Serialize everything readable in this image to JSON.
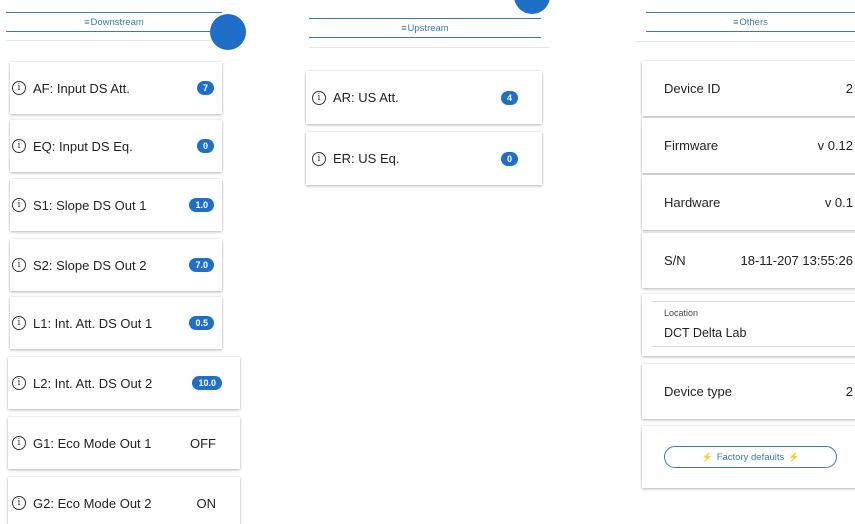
{
  "downstream": {
    "tab_label": "Downstream",
    "items": [
      {
        "label": "AF: Input DS Att.",
        "value": "7",
        "style": "badge"
      },
      {
        "label": "EQ: Input DS Eq.",
        "value": "0",
        "style": "badge"
      },
      {
        "label": "S1: Slope DS Out 1",
        "value": "1.0",
        "style": "badge"
      },
      {
        "label": "S2: Slope DS Out 2",
        "value": "7.0",
        "style": "badge"
      },
      {
        "label": "L1: Int. Att. DS Out 1",
        "value": "0.5",
        "style": "badge"
      },
      {
        "label": "L2: Int. Att. DS Out 2",
        "value": "10.0",
        "style": "badge"
      },
      {
        "label": "G1: Eco Mode Out 1",
        "value": "OFF",
        "style": "plain"
      },
      {
        "label": "G2: Eco Mode Out 2",
        "value": "ON",
        "style": "plain"
      }
    ]
  },
  "upstream": {
    "tab_label": "Upstream",
    "items": [
      {
        "label": "AR: US Att.",
        "value": "4",
        "style": "badge"
      },
      {
        "label": "ER: US Eq.",
        "value": "0",
        "style": "badge"
      }
    ]
  },
  "others": {
    "tab_label": "Others",
    "device_id": {
      "label": "Device ID",
      "value": "2"
    },
    "firmware": {
      "label": "Firmware",
      "value": "v 0.12"
    },
    "hardware": {
      "label": "Hardware",
      "value": "v 0.1"
    },
    "serial": {
      "label": "S/N",
      "value": "18-11-207 13:55:26"
    },
    "location": {
      "label": "Location",
      "value": "DCT Delta Lab"
    },
    "device_type": {
      "label": "Device type",
      "value": "2"
    },
    "factory_defaults_label": "Factory defaults"
  },
  "icons": {
    "info": "info-icon",
    "menu": "menu-icon",
    "bolt": "bolt-icon"
  },
  "colors": {
    "accent": "#1f6fc8",
    "tab_text": "#3a78b8"
  }
}
